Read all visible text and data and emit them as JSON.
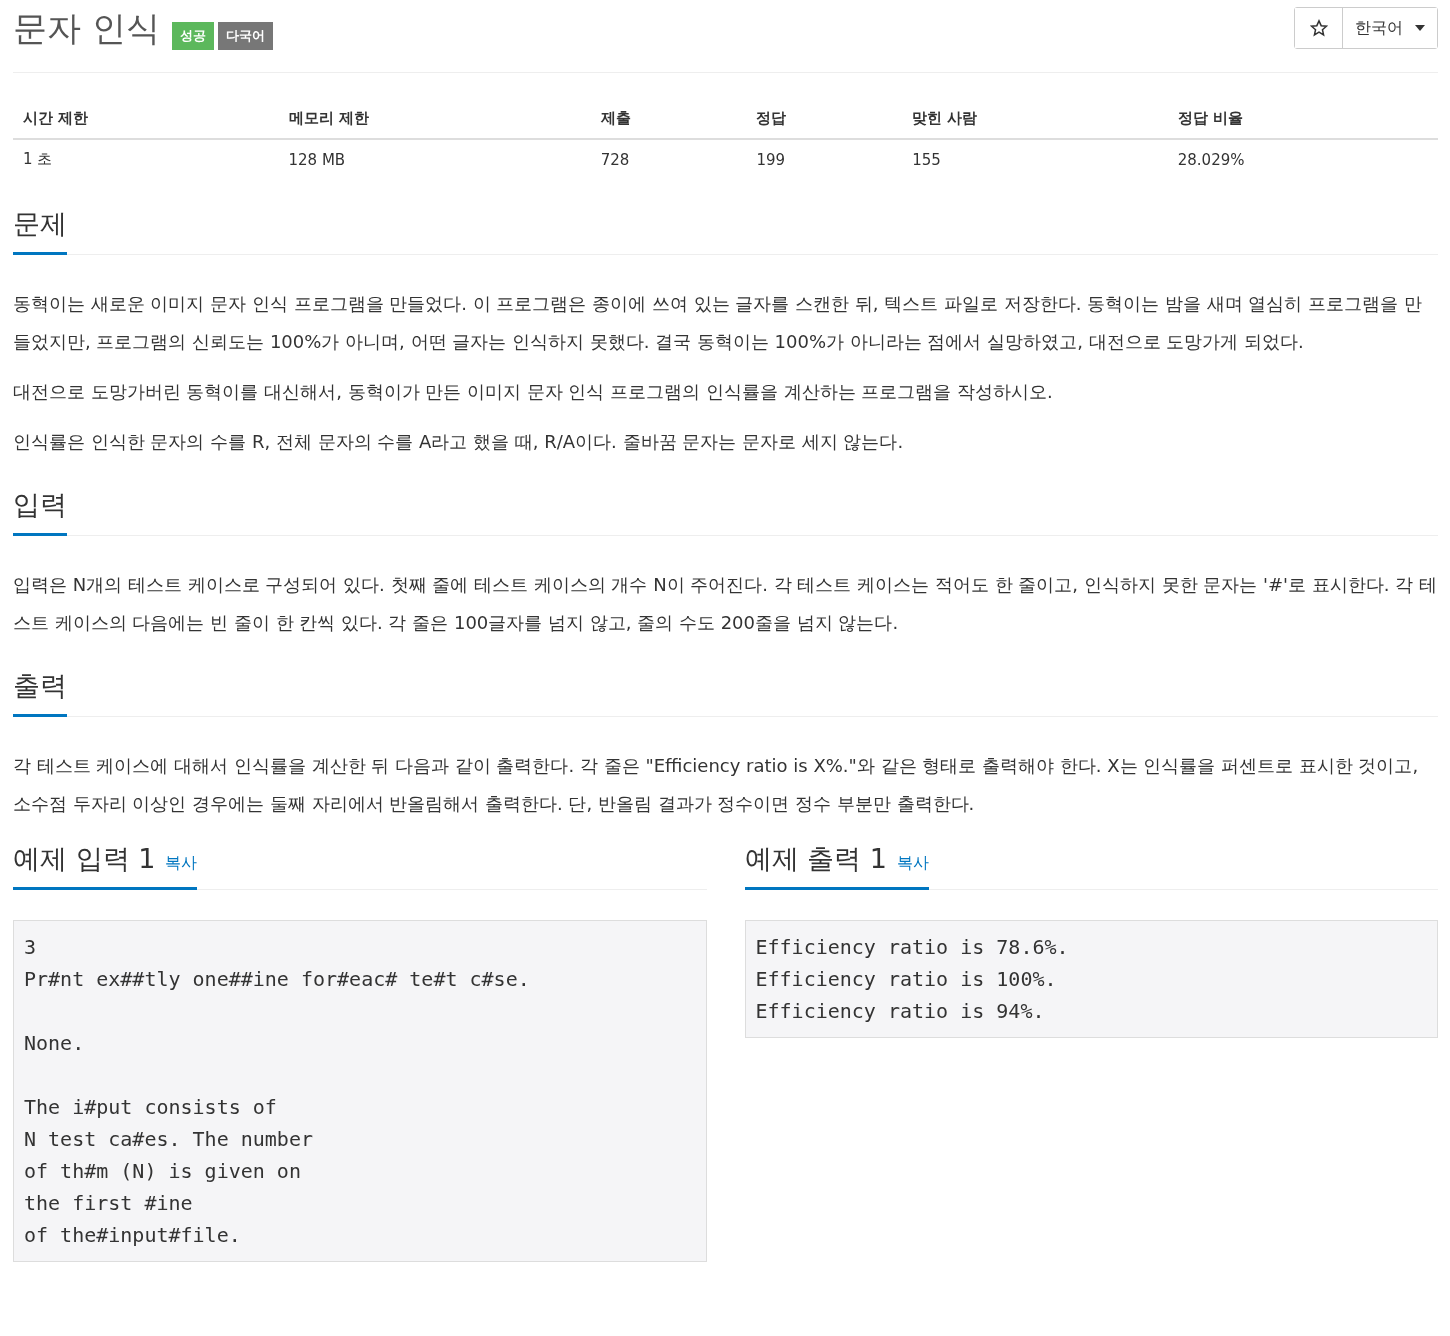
{
  "title": "문자 인식",
  "badges": [
    {
      "label": "성공",
      "kind": "success"
    },
    {
      "label": "다국어",
      "kind": "neutral"
    }
  ],
  "language": {
    "label": "한국어"
  },
  "stats": {
    "columns": [
      "시간 제한",
      "메모리 제한",
      "제출",
      "정답",
      "맞힌 사람",
      "정답 비율"
    ],
    "values": [
      "1 초",
      "128 MB",
      "728",
      "199",
      "155",
      "28.029%"
    ]
  },
  "sections": [
    {
      "heading": "문제",
      "paragraphs": [
        "동혁이는 새로운 이미지 문자 인식 프로그램을 만들었다. 이 프로그램은 종이에 쓰여 있는 글자를 스캔한 뒤, 텍스트 파일로 저장한다. 동혁이는 밤을 새며 열심히 프로그램을 만들었지만, 프로그램의 신뢰도는 100%가 아니며, 어떤 글자는 인식하지 못했다. 결국 동혁이는 100%가 아니라는 점에서 실망하였고, 대전으로 도망가게 되었다.",
        "대전으로 도망가버린 동혁이를 대신해서, 동혁이가 만든 이미지 문자 인식 프로그램의 인식률을 계산하는 프로그램을 작성하시오.",
        "인식률은 인식한 문자의 수를 R, 전체 문자의 수를 A라고 했을 때, R/A이다. 줄바꿈 문자는 문자로 세지 않는다."
      ]
    },
    {
      "heading": "입력",
      "paragraphs": [
        "입력은 N개의 테스트 케이스로 구성되어 있다. 첫째 줄에 테스트 케이스의 개수 N이 주어진다. 각 테스트 케이스는 적어도 한 줄이고, 인식하지 못한 문자는 '#'로 표시한다. 각 테스트 케이스의 다음에는 빈 줄이 한 칸씩 있다. 각 줄은 100글자를 넘지 않고, 줄의 수도 200줄을 넘지 않는다."
      ]
    },
    {
      "heading": "출력",
      "paragraphs": [
        "각 테스트 케이스에 대해서 인식률을 계산한 뒤 다음과 같이 출력한다. 각 줄은 \"Efficiency ratio is X%.\"와 같은 형태로 출력해야 한다. X는 인식률을 퍼센트로 표시한 것이고, 소수점 두자리 이상인 경우에는 둘째 자리에서 반올림해서 출력한다. 단, 반올림 결과가 정수이면 정수 부분만 출력한다."
      ]
    }
  ],
  "samples": [
    {
      "heading": "예제 입력 1",
      "copy": "복사",
      "code": "3\nPr#nt ex##tly one##ine for#eac# te#t c#se.\n\nNone.\n\nThe i#put consists of\nN test ca#es. The number\nof th#m (N) is given on\nthe first #ine\nof the#input#file.\n"
    },
    {
      "heading": "예제 출력 1",
      "copy": "복사",
      "code": "Efficiency ratio is 78.6%.\nEfficiency ratio is 100%.\nEfficiency ratio is 94%."
    }
  ]
}
